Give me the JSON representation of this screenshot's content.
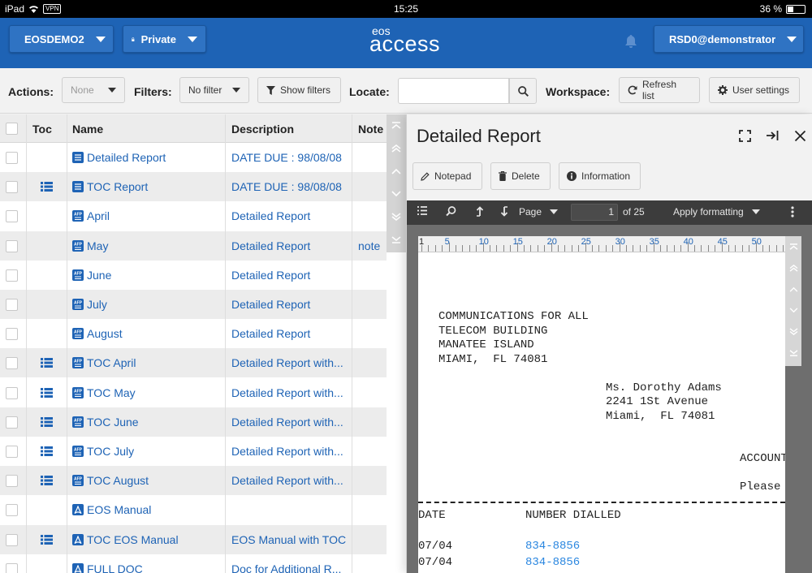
{
  "status_bar": {
    "device": "iPad",
    "vpn": "VPN",
    "time": "15:25",
    "battery": "36 %",
    "battery_level": 0.36
  },
  "header": {
    "database": "EOSDEMO2",
    "privacy": "Private",
    "logo_top": "eos",
    "logo_main": "access",
    "user": "RSD0@demonstrator"
  },
  "toolbar": {
    "actions_label": "Actions:",
    "actions_value": "None",
    "filters_label": "Filters:",
    "filters_value": "No filter",
    "show_filters": "Show filters",
    "locate_label": "Locate:",
    "locate_value": "",
    "workspace_label": "Workspace:",
    "refresh": "Refresh list",
    "user_settings": "User settings"
  },
  "table": {
    "columns": [
      "Toc",
      "Name",
      "Description",
      "Note"
    ],
    "rows": [
      {
        "toc": false,
        "icon": "report-icon",
        "name": "Detailed Report",
        "description": "DATE DUE : 98/08/08",
        "note": ""
      },
      {
        "toc": true,
        "icon": "report-icon",
        "name": "TOC Report",
        "description": "DATE DUE : 98/08/08",
        "note": ""
      },
      {
        "toc": false,
        "icon": "afp-icon",
        "name": "April",
        "description": "Detailed Report",
        "note": ""
      },
      {
        "toc": false,
        "icon": "afp-icon",
        "name": "May",
        "description": "Detailed Report",
        "note": "note"
      },
      {
        "toc": false,
        "icon": "afp-icon",
        "name": "June",
        "description": "Detailed Report",
        "note": ""
      },
      {
        "toc": false,
        "icon": "afp-icon",
        "name": "July",
        "description": "Detailed Report",
        "note": ""
      },
      {
        "toc": false,
        "icon": "afp-icon",
        "name": "August",
        "description": "Detailed Report",
        "note": ""
      },
      {
        "toc": true,
        "icon": "afp-icon",
        "name": "TOC April",
        "description": "Detailed Report with...",
        "note": ""
      },
      {
        "toc": true,
        "icon": "afp-icon",
        "name": "TOC May",
        "description": "Detailed Report with...",
        "note": ""
      },
      {
        "toc": true,
        "icon": "afp-icon",
        "name": "TOC June",
        "description": "Detailed Report with...",
        "note": ""
      },
      {
        "toc": true,
        "icon": "afp-icon",
        "name": "TOC July",
        "description": "Detailed Report with...",
        "note": ""
      },
      {
        "toc": true,
        "icon": "afp-icon",
        "name": "TOC August",
        "description": "Detailed Report with...",
        "note": ""
      },
      {
        "toc": false,
        "icon": "pdf-icon",
        "name": "EOS Manual",
        "description": "",
        "note": ""
      },
      {
        "toc": true,
        "icon": "pdf-icon",
        "name": "TOC EOS Manual",
        "description": "EOS Manual with TOC",
        "note": ""
      },
      {
        "toc": false,
        "icon": "pdf-icon",
        "name": "FULL DOC",
        "description": "Doc for Additional R...",
        "note": ""
      }
    ]
  },
  "panel": {
    "title": "Detailed Report",
    "notepad": "Notepad",
    "delete": "Delete",
    "information": "Information",
    "viewer": {
      "page_label": "Page",
      "page_value": "1",
      "page_total": "of 25",
      "apply_formatting": "Apply formatting"
    },
    "ruler_labels": [
      "1",
      "5",
      "10",
      "15",
      "20",
      "25",
      "30",
      "35",
      "40",
      "45",
      "50"
    ],
    "document": {
      "sender": [
        "COMMUNICATIONS FOR ALL",
        "TELECOM BUILDING",
        "MANATEE ISLAND",
        "MIAMI,  FL 74081"
      ],
      "recipient": [
        "Ms. Dorothy Adams",
        "2241 1St Avenue",
        "Miami,  FL 74081"
      ],
      "account": "ACCOUNT",
      "please": "Please",
      "col_date": "DATE",
      "col_number": "NUMBER DIALLED",
      "calls": [
        {
          "date": "07/04",
          "number": "834-8856"
        },
        {
          "date": "07/04",
          "number": "834-8856"
        }
      ]
    }
  },
  "colors": {
    "brand": "#1e63b5",
    "link": "#1e63b5",
    "doc_number": "#2b87e0"
  }
}
